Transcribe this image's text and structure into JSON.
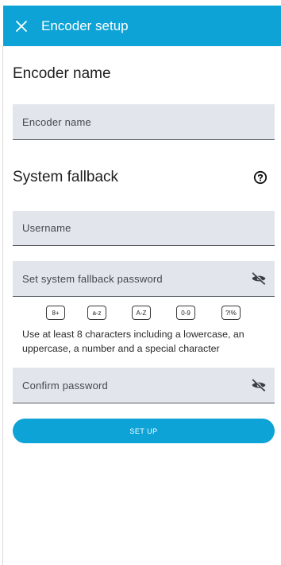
{
  "appbar": {
    "title": "Encoder setup",
    "close_icon": "close-icon"
  },
  "encoder": {
    "heading": "Encoder name",
    "name_label": "Encoder name"
  },
  "fallback": {
    "heading": "System fallback",
    "help_icon": "help-icon",
    "username_label": "Username",
    "password_label": "Set system fallback password",
    "chips": [
      "8+",
      "a-z",
      "A-Z",
      "0-9",
      "?!%"
    ],
    "hint": "Use at least 8 characters including a lowercase, an uppercase, a number and a special character",
    "confirm_label": "Confirm password",
    "visibility_icon": "visibility-off-icon"
  },
  "actions": {
    "setup_label": "SET UP"
  },
  "colors": {
    "accent": "#0da3d6",
    "field_bg": "#e3e5ec"
  }
}
